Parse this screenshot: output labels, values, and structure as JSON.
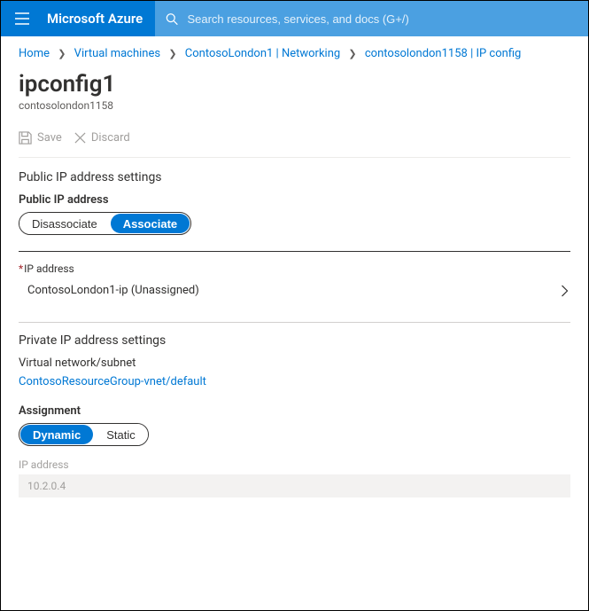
{
  "brand": "Microsoft Azure",
  "search": {
    "placeholder": "Search resources, services, and docs (G+/)"
  },
  "breadcrumb": [
    {
      "label": "Home"
    },
    {
      "label": "Virtual machines"
    },
    {
      "label": "ContosoLondon1 | Networking"
    },
    {
      "label": "contosolondon1158 | IP config"
    }
  ],
  "page": {
    "title": "ipconfig1",
    "subtitle": "contosolondon1158"
  },
  "toolbar": {
    "save": "Save",
    "discard": "Discard"
  },
  "public_ip": {
    "section": "Public IP address settings",
    "label": "Public IP address",
    "options": {
      "disassociate": "Disassociate",
      "associate": "Associate"
    },
    "selected": "associate",
    "ip_field_label": "IP address",
    "ip_value": "ContosoLondon1-ip (Unassigned)"
  },
  "private_ip": {
    "section": "Private IP address settings",
    "vnet_label": "Virtual network/subnet",
    "vnet_link": "ContosoResourceGroup-vnet/default",
    "assignment_label": "Assignment",
    "options": {
      "dynamic": "Dynamic",
      "static": "Static"
    },
    "selected": "dynamic",
    "ip_label": "IP address",
    "ip_value": "10.2.0.4"
  }
}
